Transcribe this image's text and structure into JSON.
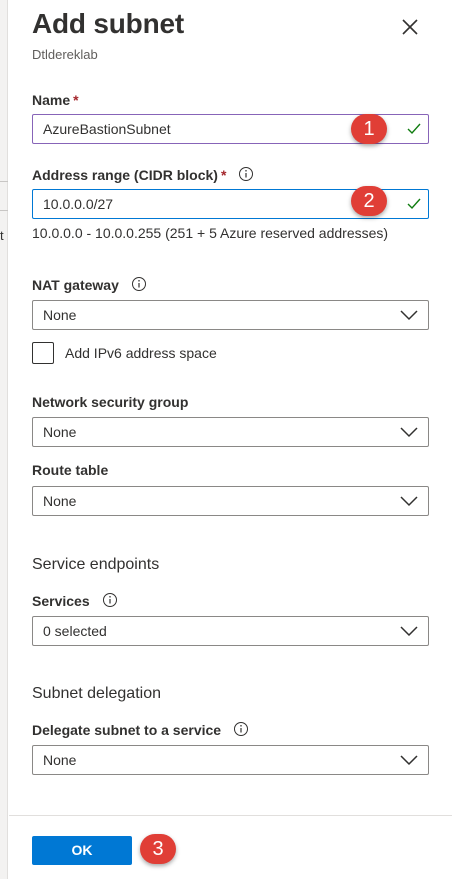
{
  "header": {
    "title": "Add subnet",
    "subtitle": "Dtldereklab"
  },
  "name_field": {
    "label": "Name",
    "required_mark": "*",
    "value": "AzureBastionSubnet"
  },
  "address_field": {
    "label": "Address range (CIDR block)",
    "required_mark": "*",
    "value": "10.0.0.0/27",
    "hint": "10.0.0.0 - 10.0.0.255 (251 + 5 Azure reserved addresses)"
  },
  "nat_gateway": {
    "label": "NAT gateway",
    "selected": "None"
  },
  "ipv6": {
    "label": "Add IPv6 address space",
    "checked": false
  },
  "nsg": {
    "label": "Network security group",
    "selected": "None"
  },
  "route_table": {
    "label": "Route table",
    "selected": "None"
  },
  "service_endpoints": {
    "section_title": "Service endpoints",
    "label": "Services",
    "selected": "0 selected"
  },
  "subnet_delegation": {
    "section_title": "Subnet delegation",
    "label": "Delegate subnet to a service",
    "selected": "None"
  },
  "footer": {
    "ok_label": "OK"
  },
  "annotations": {
    "badge_1": "1",
    "badge_2": "2",
    "badge_3": "3"
  },
  "background": {
    "peek_text": "t"
  },
  "colors": {
    "accent": "#0078d4",
    "required": "#a4262c",
    "valid_check": "#107c10",
    "badge": "#e03e36",
    "focus_purple": "#8764b8"
  }
}
